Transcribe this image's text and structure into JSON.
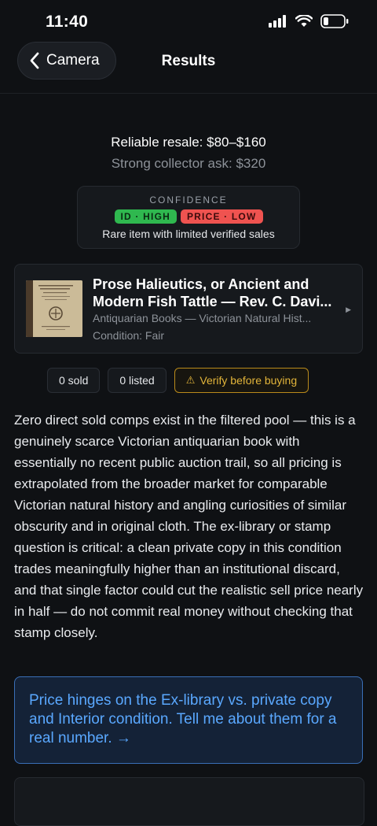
{
  "status_bar": {
    "time": "11:40"
  },
  "nav": {
    "back_label": "Camera",
    "title": "Results"
  },
  "pricing": {
    "resale": "Reliable resale: $80–$160",
    "ask": "Strong collector ask: $320"
  },
  "confidence": {
    "label": "CONFIDENCE",
    "id_badge": "ID · HIGH",
    "price_badge": "PRICE · LOW",
    "note": "Rare item with limited verified sales",
    "colors": {
      "id": "#2fb84f",
      "price": "#ef5350"
    }
  },
  "item": {
    "title_line1": "Prose Halieutics, or Ancient and",
    "title_line2": "Modern Fish Tattle — Rev. C. Davi...",
    "category": "Antiquarian Books — Victorian Natural Hist...",
    "condition": "Condition: Fair"
  },
  "chips": {
    "sold": "0 sold",
    "listed": "0 listed",
    "warning": "Verify before buying"
  },
  "analysis": "Zero direct sold comps exist in the filtered pool — this is a genuinely scarce Victorian antiquarian book with essentially no recent public auction trail, so all pricing is extrapolated from the broader market for comparable Victorian natural history and angling curiosities of similar obscurity and in original cloth. The ex-library or stamp question is critical: a clean private copy in this condition trades meaningfully higher than an institutional discard, and that single factor could cut the realistic sell price nearly in half — do not commit real money without checking that stamp closely.",
  "cta": "Price hinges on the Ex-library vs. private copy and Interior condition. Tell me about them for a real number. →",
  "colors": {
    "background": "#0f1114",
    "accent": "#5aa8ff",
    "warning": "#e2b43a"
  }
}
